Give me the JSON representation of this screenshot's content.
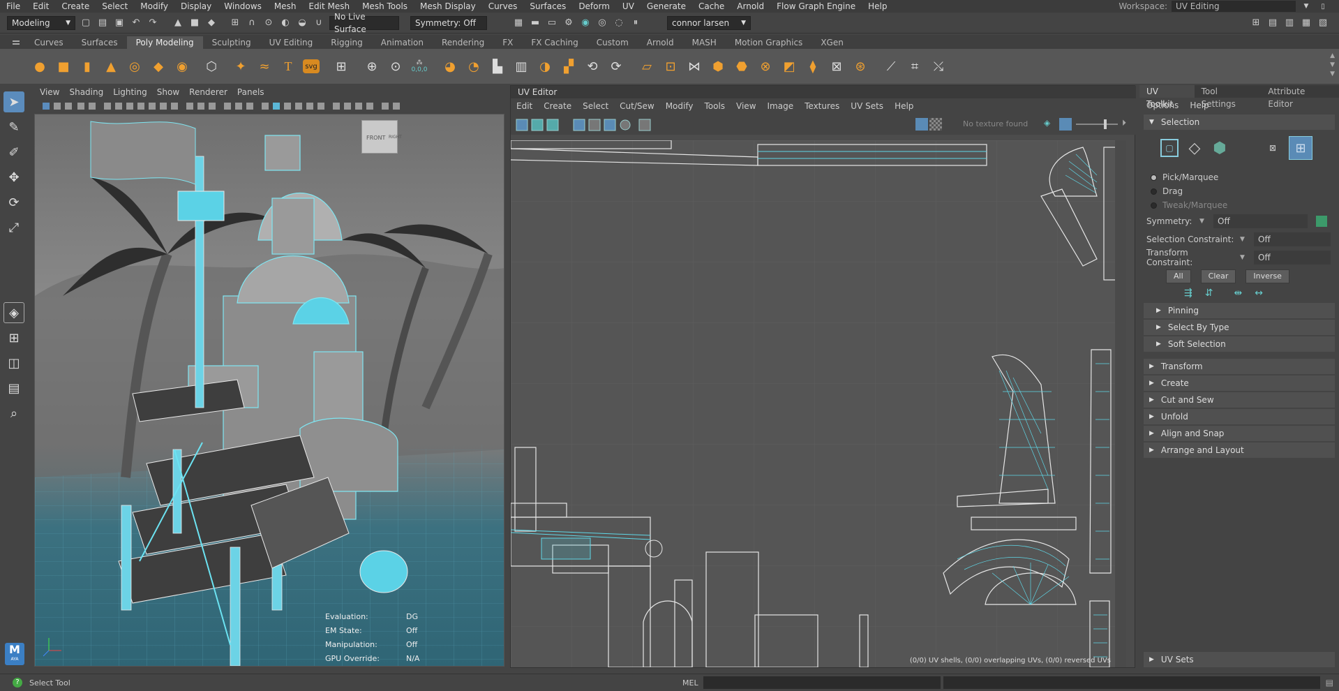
{
  "menubar": {
    "items": [
      "File",
      "Edit",
      "Create",
      "Select",
      "Modify",
      "Display",
      "Windows",
      "Mesh",
      "Edit Mesh",
      "Mesh Tools",
      "Mesh Display",
      "Curves",
      "Surfaces",
      "Deform",
      "UV",
      "Generate",
      "Cache",
      "Arnold",
      "Flow Graph Engine",
      "Help"
    ],
    "workspace_label": "Workspace:",
    "workspace_value": "UV Editing"
  },
  "statusline": {
    "mode": "Modeling",
    "live_surface": "No Live Surface",
    "symmetry": "Symmetry: Off",
    "user": "connor larsen"
  },
  "shelf": {
    "tabs": [
      "Curves",
      "Surfaces",
      "Poly Modeling",
      "Sculpting",
      "UV Editing",
      "Rigging",
      "Animation",
      "Rendering",
      "FX",
      "FX Caching",
      "Custom",
      "Arnold",
      "MASH",
      "Motion Graphics",
      "XGen"
    ],
    "active_tab": "Poly Modeling",
    "svg_label": "svg",
    "coord_label": "0,0,0"
  },
  "viewport": {
    "menus": [
      "View",
      "Shading",
      "Lighting",
      "Show",
      "Renderer",
      "Panels"
    ],
    "cube_label": "FRONT",
    "cube_side": "RIGHT",
    "hud": [
      {
        "key": "Evaluation:",
        "value": "DG"
      },
      {
        "key": "EM State:",
        "value": "Off"
      },
      {
        "key": "Manipulation:",
        "value": "Off"
      },
      {
        "key": "GPU Override:",
        "value": "N/A"
      }
    ]
  },
  "uv_editor": {
    "title": "UV Editor",
    "menus": [
      "Edit",
      "Create",
      "Select",
      "Cut/Sew",
      "Modify",
      "Tools",
      "View",
      "Image",
      "Textures",
      "UV Sets",
      "Help"
    ],
    "texture_status": "No texture found",
    "footer": "(0/0) UV shells, (0/0) overlapping UVs, (0/0) reversed UVs"
  },
  "right_panel": {
    "tabs": [
      "UV Toolkit",
      "Tool Settings",
      "Attribute Editor"
    ],
    "active_tab": "UV Toolkit",
    "sub_menus": [
      "Options",
      "Help"
    ],
    "selection_title": "Selection",
    "modes": [
      "Pick/Marquee",
      "Drag",
      "Tweak/Marquee"
    ],
    "symmetry_label": "Symmetry:",
    "symmetry_value": "Off",
    "sel_constraint_label": "Selection Constraint:",
    "sel_constraint_value": "Off",
    "transform_constraint_label": "Transform Constraint:",
    "transform_constraint_value": "Off",
    "buttons": [
      "All",
      "Clear",
      "Inverse"
    ],
    "sub_sections": [
      "Pinning",
      "Select By Type",
      "Soft Selection"
    ],
    "sections": [
      "Transform",
      "Create",
      "Cut and Sew",
      "Unfold",
      "Align and Snap",
      "Arrange and Layout"
    ],
    "bottom_section": "UV Sets"
  },
  "bottombar": {
    "help_text": "Select Tool",
    "cmd_label": "MEL"
  },
  "logo": {
    "letter": "M",
    "sub": "AYA"
  }
}
